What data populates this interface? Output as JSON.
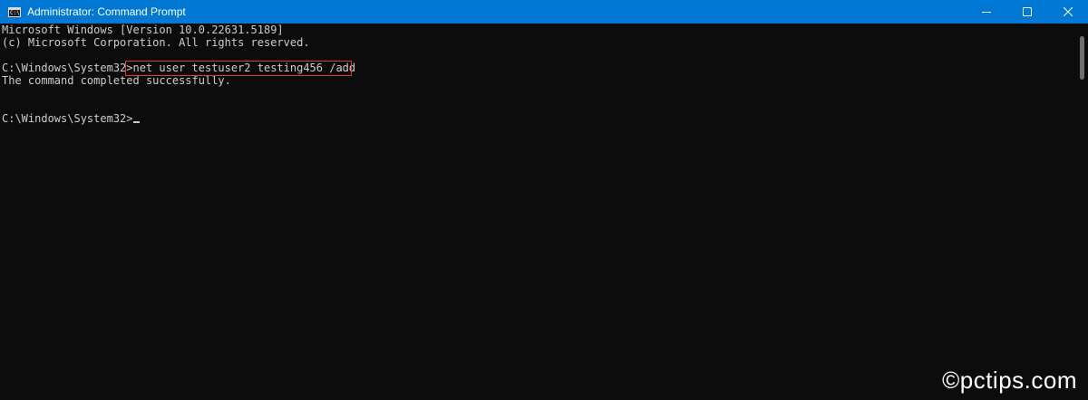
{
  "window": {
    "title": "Administrator: Command Prompt",
    "icon": "cmd-icon",
    "icon_glyph": "C:\\",
    "titlebar_color": "#0078d4",
    "controls": [
      "minimize",
      "maximize",
      "close"
    ]
  },
  "console": {
    "background_color": "#0c0c0c",
    "text_color": "#cccccc",
    "lines": [
      "Microsoft Windows [Version 10.0.22631.5189]",
      "(c) Microsoft Corporation. All rights reserved.",
      "",
      "C:\\Windows\\System32>net user testuser2 testing456 /add",
      "The command completed successfully.",
      "",
      "",
      "C:\\Windows\\System32>"
    ],
    "highlight_color": "#e53935",
    "highlighted_command": "net user testuser2 testing456 /add"
  },
  "watermark": {
    "text": "©pctips.com"
  }
}
